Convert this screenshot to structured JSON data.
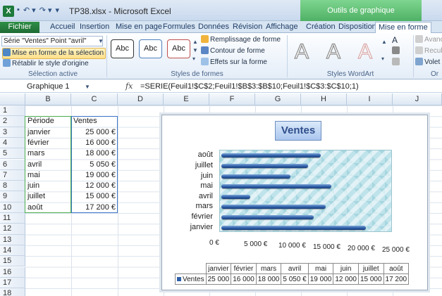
{
  "window": {
    "title": "TP38.xlsx - Microsoft Excel",
    "context_title": "Outils de graphique",
    "app_icon_letter": "X"
  },
  "qat": {
    "save": "▪",
    "undo": "↶ ▾",
    "redo": "↷ ▾",
    "customize": "▾"
  },
  "tabs": [
    {
      "label": "Fichier"
    },
    {
      "label": "Accueil"
    },
    {
      "label": "Insertion"
    },
    {
      "label": "Mise en page"
    },
    {
      "label": "Formules"
    },
    {
      "label": "Données"
    },
    {
      "label": "Révision"
    },
    {
      "label": "Affichage"
    },
    {
      "label": "Création"
    },
    {
      "label": "Disposition"
    },
    {
      "label": "Mise en forme"
    }
  ],
  "ribbon": {
    "selection_combo": "Série \"Ventes\" Point \"avril\"",
    "format_selection": "Mise en forme de la sélection",
    "reset_style": "Rétablir le style d'origine",
    "group_active_selection": "Sélection active",
    "shape_sample": "Abc",
    "fill": "Remplissage de forme",
    "outline": "Contour de forme",
    "effects": "Effets sur la forme",
    "group_shape_styles": "Styles de formes",
    "wordart_letter": "A",
    "group_wordart": "Styles WordArt",
    "arrange_forward": "Avanc",
    "arrange_back": "Recule",
    "arrange_pane": "Volet",
    "group_arrange": "Or",
    "text_fill_letter": "A"
  },
  "formula_bar": {
    "name_box": "Graphique 1",
    "fx": "fx",
    "formula": "=SERIE(Feuil1!$C$2;Feuil1!$B$3:$B$10;Feuil1!$C$3:$C$10;1)"
  },
  "columns": [
    "B",
    "C",
    "D",
    "E",
    "F",
    "G",
    "H",
    "I",
    "J"
  ],
  "rows": [
    "1",
    "2",
    "3",
    "4",
    "5",
    "6",
    "7",
    "8",
    "9",
    "10",
    "11",
    "12",
    "13",
    "14",
    "15",
    "16",
    "17",
    "18"
  ],
  "sheet": {
    "header_period": "Période",
    "header_sales": "Ventes",
    "periods": [
      "janvier",
      "février",
      "mars",
      "avril",
      "mai",
      "juin",
      "juillet",
      "août"
    ],
    "sales": [
      "25 000 €",
      "16 000 €",
      "18 000 €",
      "5 050 €",
      "19 000 €",
      "12 000 €",
      "15 000 €",
      "17 200 €"
    ]
  },
  "chart_data": {
    "type": "bar",
    "title": "Ventes",
    "categories": [
      "janvier",
      "février",
      "mars",
      "avril",
      "mai",
      "juin",
      "juillet",
      "août"
    ],
    "series": [
      {
        "name": "Ventes",
        "values": [
          25000,
          16000,
          18000,
          5050,
          19000,
          12000,
          15000,
          17200
        ]
      }
    ],
    "xlim": [
      0,
      25000
    ],
    "x_ticks": [
      "0 €",
      "5 000 €",
      "10 000 €",
      "15 000 €",
      "20 000 €",
      "25 000 €"
    ],
    "data_table": {
      "values": [
        "25 000",
        "16 000",
        "18 000",
        "5 050 €",
        "19 000",
        "12 000",
        "15 000",
        "17 200"
      ]
    },
    "orientation": "horizontal",
    "colors": {
      "bar": "#2e5fa8"
    }
  }
}
